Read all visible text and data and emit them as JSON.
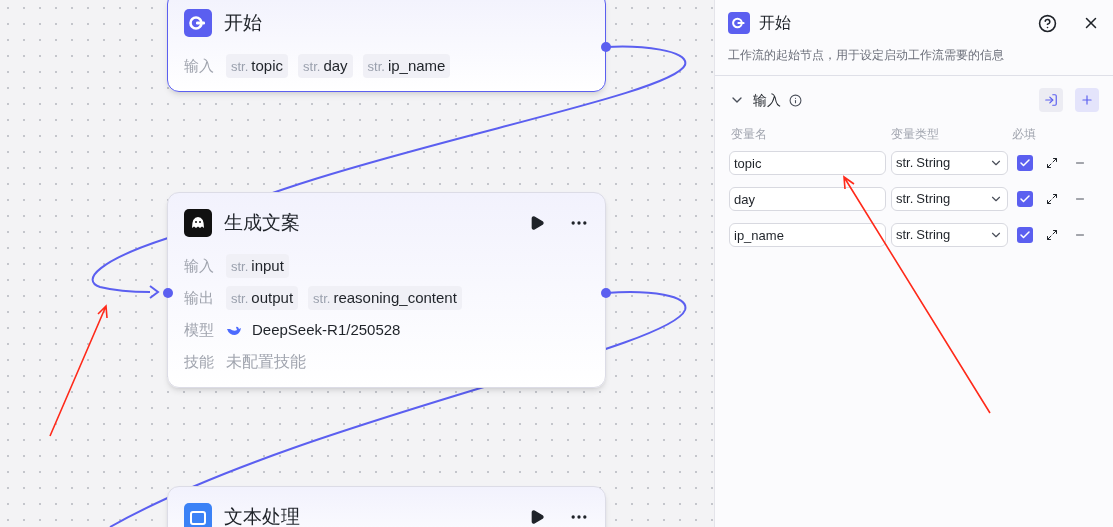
{
  "canvas": {
    "nodes": [
      {
        "kind": "start",
        "title": "开始",
        "selected": true,
        "rows": [
          {
            "kind": "tags",
            "label": "输入",
            "tags": [
              {
                "prefix": "str.",
                "name": "topic"
              },
              {
                "prefix": "str.",
                "name": "day"
              },
              {
                "prefix": "str.",
                "name": "ip_name"
              }
            ]
          }
        ]
      },
      {
        "kind": "llm",
        "title": "生成文案",
        "selected": false,
        "rows": [
          {
            "kind": "tags",
            "label": "输入",
            "tags": [
              {
                "prefix": "str.",
                "name": "input"
              }
            ]
          },
          {
            "kind": "tags",
            "label": "输出",
            "tags": [
              {
                "prefix": "str.",
                "name": "output"
              },
              {
                "prefix": "str.",
                "name": "reasoning_content"
              }
            ]
          },
          {
            "kind": "model",
            "label": "模型",
            "value": "DeepSeek-R1/250528"
          },
          {
            "kind": "empty",
            "label": "技能",
            "value": "未配置技能"
          }
        ]
      },
      {
        "kind": "text",
        "title": "文本处理",
        "selected": false
      }
    ]
  },
  "panel": {
    "title": "开始",
    "description": "工作流的起始节点，用于设定启动工作流需要的信息",
    "section": {
      "title": "输入",
      "expanded": true,
      "columns": [
        "变量名",
        "变量类型",
        "必填"
      ],
      "rows": [
        {
          "name": "topic",
          "type_prefix": "str.",
          "type": "String",
          "required": true
        },
        {
          "name": "day",
          "type_prefix": "str.",
          "type": "String",
          "required": true
        },
        {
          "name": "ip_name",
          "type_prefix": "str.",
          "type": "String",
          "required": true
        }
      ]
    }
  }
}
